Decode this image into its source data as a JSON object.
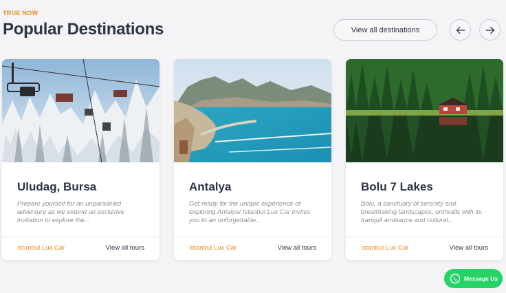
{
  "header": {
    "eyebrow": "TRUE NOW",
    "title": "Popular Destinations",
    "view_all_label": "View all destinations"
  },
  "navigation": {
    "prev_icon": "arrow-left-icon",
    "next_icon": "arrow-right-icon"
  },
  "cards": [
    {
      "title": "Uludag, Bursa",
      "description": "Prepare yourself for an unparalleled adventure as we extend an exclusive invitation to explore the...",
      "brand": "Istanbul Lux Car",
      "link": "View all tours",
      "image": "snowy-ski-lift"
    },
    {
      "title": "Antalya",
      "description": "Get ready for the unique experience of exploring Antalya! Istanbul Lux Car invites you to an unforgettable...",
      "brand": "Istanbul Lux Car",
      "link": "View all tours",
      "image": "coastal-city-bay"
    },
    {
      "title": "Bolu 7 Lakes",
      "description": "Bolu, a sanctuary of serenity and breathtaking landscapes, enthralls with its tranquil ambiance and cultural...",
      "brand": "Istanbul Lux Car",
      "link": "View all tours",
      "image": "forest-lake-house"
    }
  ],
  "whatsapp": {
    "label": "Message Us",
    "icon": "whatsapp-icon"
  },
  "colors": {
    "accent": "#f08a1c",
    "heading": "#2c3447",
    "whatsapp": "#25d366"
  }
}
